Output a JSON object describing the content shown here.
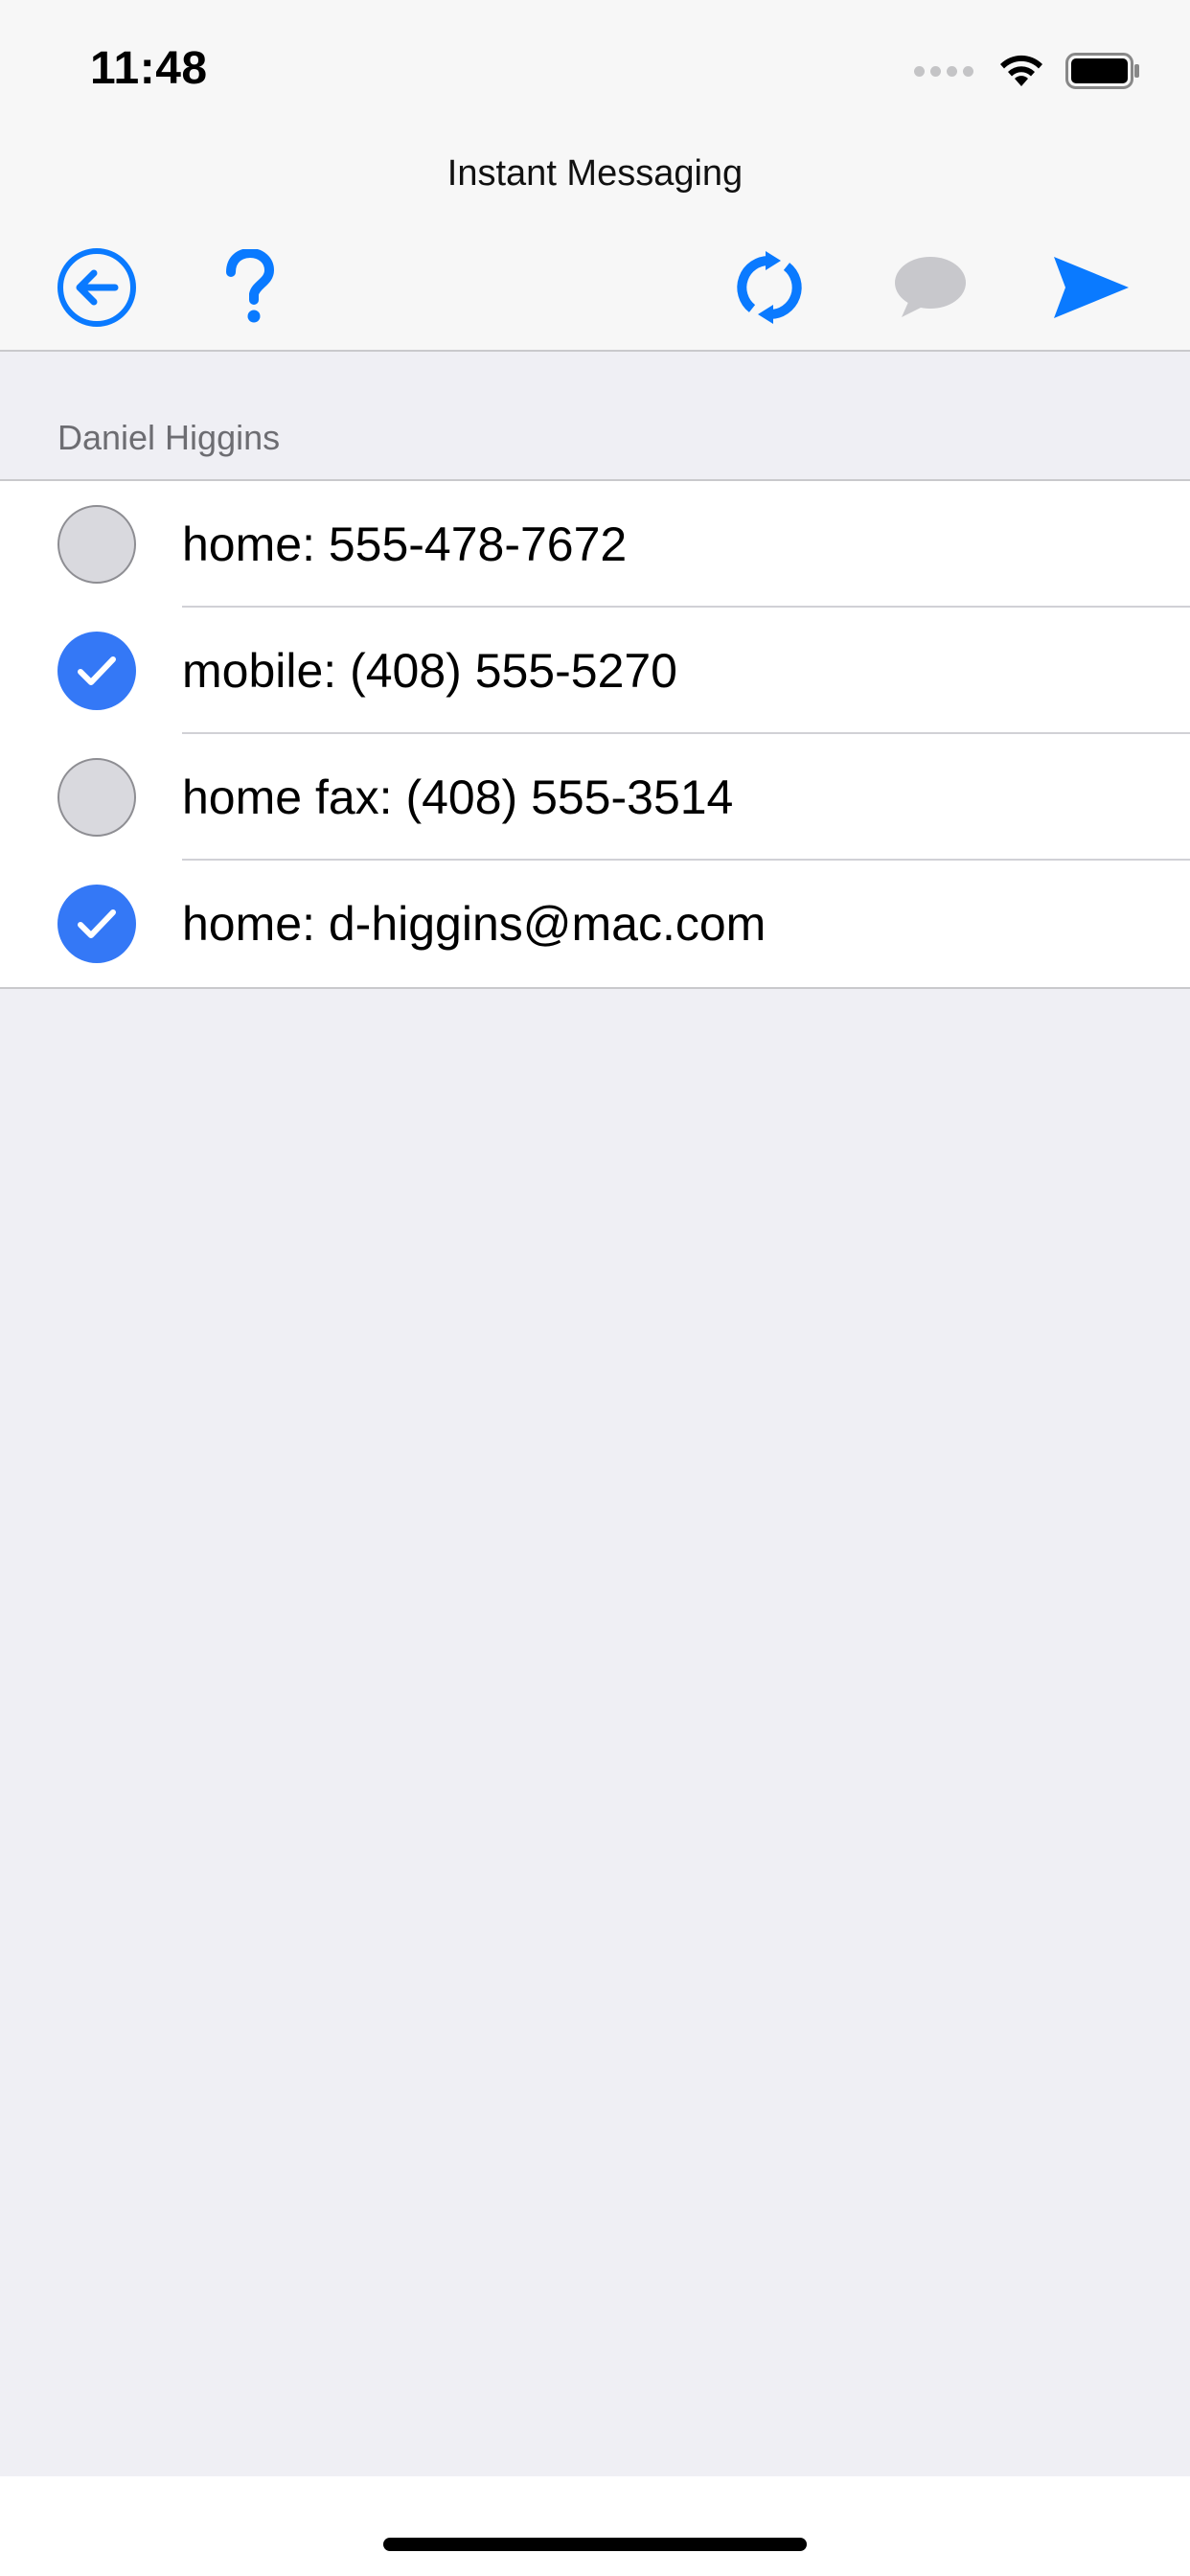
{
  "status_bar": {
    "time": "11:48",
    "signal_icon": "cellular-signal-icon",
    "wifi_icon": "wifi-icon",
    "battery_icon": "battery-icon"
  },
  "nav": {
    "title": "Instant Messaging"
  },
  "toolbar": {
    "back_icon": "back-arrow-circle-icon",
    "help_icon": "question-mark-icon",
    "refresh_icon": "refresh-icon",
    "message_icon": "speech-bubble-icon",
    "send_icon": "send-icon"
  },
  "contact": {
    "name": "Daniel Higgins",
    "entries": [
      {
        "label": "home: 555-478-7672",
        "selected": false
      },
      {
        "label": "mobile: (408) 555-5270",
        "selected": true
      },
      {
        "label": "home fax: (408) 555-3514",
        "selected": false
      },
      {
        "label": "home: d-higgins@mac.com",
        "selected": true
      }
    ]
  },
  "colors": {
    "accent": "#3478f6",
    "toolbar_blue": "#0a7aff",
    "disabled_icon": "#c8c8cc",
    "background": "#efeff4"
  }
}
